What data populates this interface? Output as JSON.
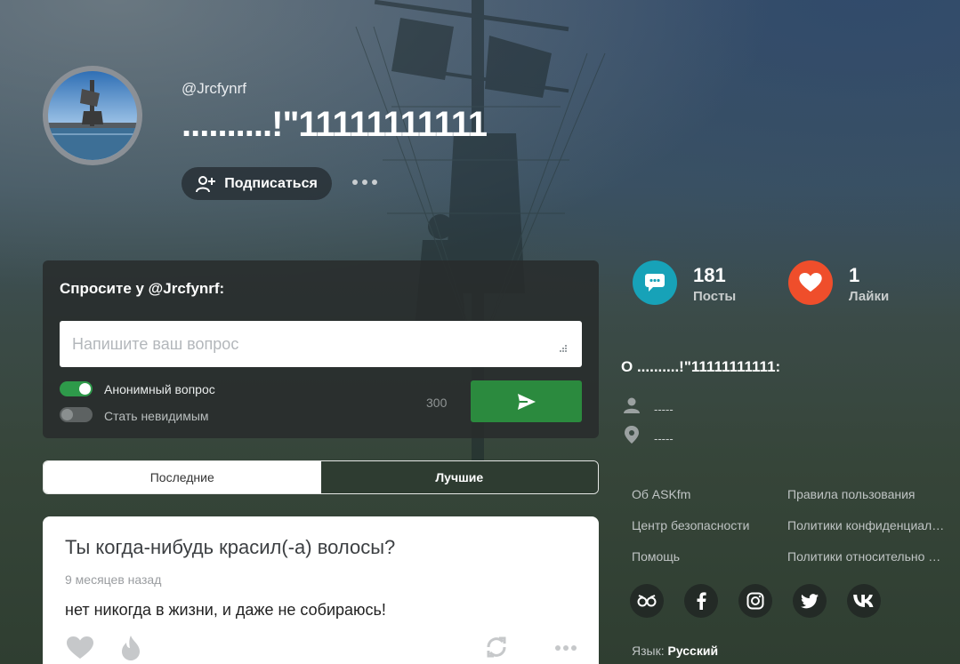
{
  "profile": {
    "username": "@Jrcfynrf",
    "display_name": "..........!\"11111111111",
    "follow_label": "Подписаться"
  },
  "ask": {
    "title": "Спросите у @Jrcfynrf:",
    "placeholder": "Напишите ваш вопрос",
    "anonymous_label": "Анонимный вопрос",
    "anonymous_on": true,
    "invisible_label": "Стать невидимым",
    "invisible_on": false,
    "char_count": "300"
  },
  "tabs": [
    {
      "label": "Последние",
      "active": true
    },
    {
      "label": "Лучшие",
      "active": false
    }
  ],
  "post": {
    "question": "Ты когда-нибудь красил(-а) волосы?",
    "time": "9 месяцев назад",
    "answer": "нет никогда в жизни, и даже не собираюсь!"
  },
  "stats": {
    "posts_count": "181",
    "posts_label": "Посты",
    "likes_count": "1",
    "likes_label": "Лайки"
  },
  "about": {
    "title": "О ..........!\"11111111111:",
    "name_value": "-----",
    "location_value": "-----"
  },
  "footer": {
    "links": [
      "Об ASKfm",
      "Правила пользования",
      "Центр безопасности",
      "Политики конфиденциальности",
      "Помощь",
      "Политики относительно файлов cookie"
    ],
    "language_label": "Язык:",
    "language_value": "Русский"
  },
  "colors": {
    "accent_green": "#2b8a3e",
    "posts_teal": "#17a2b8",
    "likes_orange": "#ef4e2b"
  },
  "icons": [
    "add-user-icon",
    "send-icon",
    "chat-icon",
    "heart-icon",
    "person-icon",
    "location-pin-icon",
    "fire-icon",
    "share-icon",
    "askfm-icon",
    "facebook-icon",
    "instagram-icon",
    "twitter-icon",
    "vk-icon"
  ]
}
